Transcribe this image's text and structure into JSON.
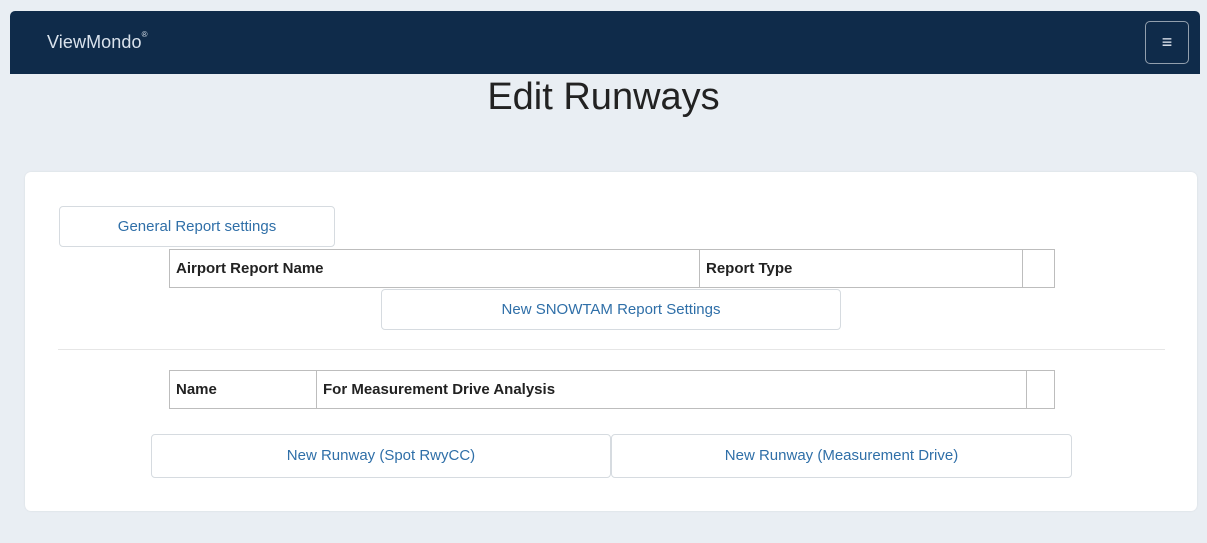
{
  "navbar": {
    "brand": "ViewMondo",
    "brand_mark": "®",
    "menu_icon": "hamburger-menu-icon",
    "menu_glyph": "≡"
  },
  "page": {
    "title": "Edit Runways"
  },
  "report_section": {
    "general_button": "General Report settings",
    "table_headers": [
      "Airport Report Name",
      "Report Type",
      ""
    ],
    "new_report_button": "New SNOWTAM Report Settings"
  },
  "runway_section": {
    "table_headers": [
      "Name",
      "For Measurement Drive Analysis",
      ""
    ],
    "new_spot_button": "New Runway (Spot RwyCC)",
    "new_drive_button": "New Runway (Measurement Drive)"
  },
  "colors": {
    "navbar_bg": "#0f2b4a",
    "page_bg": "#e9eef3",
    "link": "#2f6fa8"
  }
}
